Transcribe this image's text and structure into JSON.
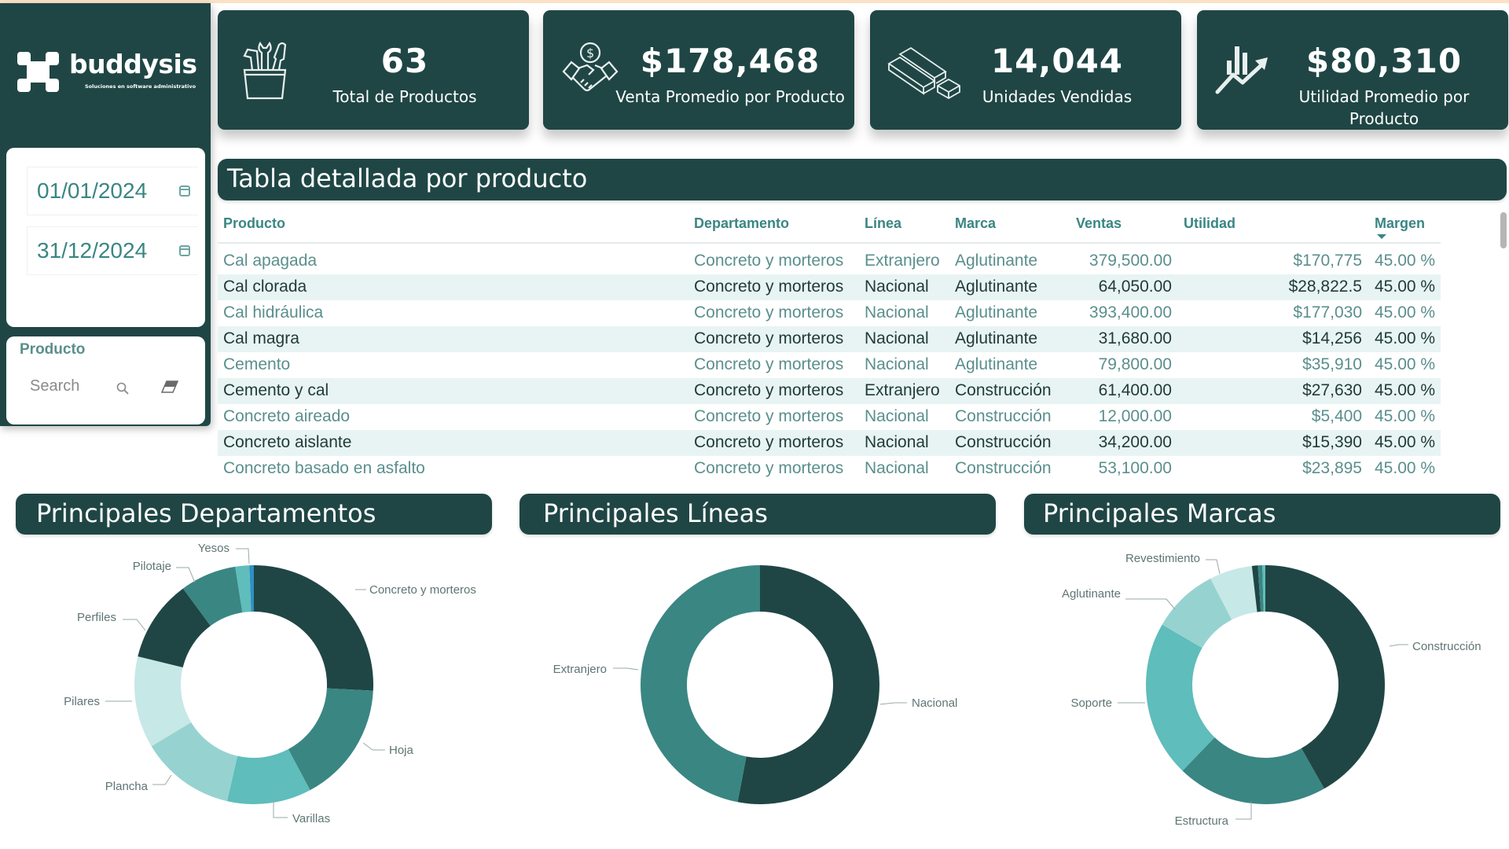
{
  "brand": {
    "name": "buddysis",
    "tagline": "Soluciones en software administrativo"
  },
  "colors": {
    "primary": "#1f4645",
    "top_stripe": "#fbe2c6",
    "accent_teal": "#3a8683",
    "row_alt": "#e8f4f4"
  },
  "filters": {
    "start_date": "01/01/2024",
    "end_date": "31/12/2024",
    "calendar_icon": "calendar-icon",
    "product_slicer": {
      "label": "Producto",
      "search_placeholder": "Search",
      "search_value": "",
      "search_icon": "search-icon",
      "clear_icon": "eraser-icon"
    }
  },
  "kpis": [
    {
      "icon": "tools-bucket-icon",
      "value": "63",
      "label": "Total de Productos"
    },
    {
      "icon": "handshake-money-icon",
      "value": "$178,468",
      "label": "Venta Promedio por Producto"
    },
    {
      "icon": "lumber-stack-icon",
      "value": "14,044",
      "label": "Unidades Vendidas"
    },
    {
      "icon": "chart-growth-icon",
      "value": "$80,310",
      "label": "Utilidad Promedio por Producto"
    }
  ],
  "table": {
    "title": "Tabla detallada por producto",
    "sorted_by": "Margen",
    "sort_direction": "descending",
    "columns": [
      "Producto",
      "Departamento",
      "Línea",
      "Marca",
      "Ventas",
      "Utilidad",
      "Margen"
    ],
    "rows": [
      {
        "producto": "Cal apagada",
        "departamento": "Concreto y morteros",
        "linea": "Extranjero",
        "marca": "Aglutinante",
        "ventas": "379,500.00",
        "utilidad": "$170,775",
        "margen": "45.00 %"
      },
      {
        "producto": "Cal clorada",
        "departamento": "Concreto y morteros",
        "linea": "Nacional",
        "marca": "Aglutinante",
        "ventas": "64,050.00",
        "utilidad": "$28,822.5",
        "margen": "45.00 %"
      },
      {
        "producto": "Cal hidráulica",
        "departamento": "Concreto y morteros",
        "linea": "Nacional",
        "marca": "Aglutinante",
        "ventas": "393,400.00",
        "utilidad": "$177,030",
        "margen": "45.00 %"
      },
      {
        "producto": "Cal magra",
        "departamento": "Concreto y morteros",
        "linea": "Nacional",
        "marca": "Aglutinante",
        "ventas": "31,680.00",
        "utilidad": "$14,256",
        "margen": "45.00 %"
      },
      {
        "producto": "Cemento",
        "departamento": "Concreto y morteros",
        "linea": "Nacional",
        "marca": "Aglutinante",
        "ventas": "79,800.00",
        "utilidad": "$35,910",
        "margen": "45.00 %"
      },
      {
        "producto": "Cemento y cal",
        "departamento": "Concreto y morteros",
        "linea": "Extranjero",
        "marca": "Construcción",
        "ventas": "61,400.00",
        "utilidad": "$27,630",
        "margen": "45.00 %"
      },
      {
        "producto": "Concreto aireado",
        "departamento": "Concreto y morteros",
        "linea": "Nacional",
        "marca": "Construcción",
        "ventas": "12,000.00",
        "utilidad": "$5,400",
        "margen": "45.00 %"
      },
      {
        "producto": "Concreto aislante",
        "departamento": "Concreto y morteros",
        "linea": "Nacional",
        "marca": "Construcción",
        "ventas": "34,200.00",
        "utilidad": "$15,390",
        "margen": "45.00 %"
      },
      {
        "producto": "Concreto basado en asfalto",
        "departamento": "Concreto y morteros",
        "linea": "Nacional",
        "marca": "Construcción",
        "ventas": "53,100.00",
        "utilidad": "$23,895",
        "margen": "45.00 %"
      }
    ]
  },
  "chart_data": [
    {
      "type": "pie",
      "variant": "donut",
      "title": "Principales Departamentos",
      "unit": "percent_of_total_estimated",
      "slices": [
        {
          "label": "Concreto y morteros",
          "value": 25.8,
          "color": "#1f4645"
        },
        {
          "label": "Hoja",
          "value": 16.4,
          "color": "#3a8683"
        },
        {
          "label": "Varillas",
          "value": 11.4,
          "color": "#5fbdbb"
        },
        {
          "label": "Plancha",
          "value": 12.8,
          "color": "#96d3d0"
        },
        {
          "label": "Pilares",
          "value": 12.4,
          "color": "#c6e8e7"
        },
        {
          "label": "Perfiles",
          "value": 11.1,
          "color": "#1f4645"
        },
        {
          "label": "Pilotaje",
          "value": 7.6,
          "color": "#3a8683"
        },
        {
          "label": "Yesos",
          "value": 1.9,
          "color": "#5fbdbb"
        },
        {
          "label": "",
          "value": 0.6,
          "color": "#2f8fc2"
        }
      ],
      "legend": "outside-labels"
    },
    {
      "type": "pie",
      "variant": "donut",
      "title": "Principales Líneas",
      "unit": "percent_of_total_estimated",
      "slices": [
        {
          "label": "Nacional",
          "value": 53,
          "color": "#1f4645"
        },
        {
          "label": "Extranjero",
          "value": 47,
          "color": "#3a8683"
        }
      ],
      "legend": "outside-labels"
    },
    {
      "type": "pie",
      "variant": "donut",
      "title": "Principales Marcas",
      "unit": "percent_of_total_estimated",
      "slices": [
        {
          "label": "Construcción",
          "value": 41.8,
          "color": "#1f4645"
        },
        {
          "label": "Estructura",
          "value": 20.4,
          "color": "#3a8683"
        },
        {
          "label": "Soporte",
          "value": 21.2,
          "color": "#5fbdbb"
        },
        {
          "label": "Aglutinante",
          "value": 9.0,
          "color": "#96d3d0"
        },
        {
          "label": "Revestimiento",
          "value": 5.8,
          "color": "#c6e8e7"
        },
        {
          "label": "",
          "value": 0.8,
          "color": "#1f4645"
        },
        {
          "label": "",
          "value": 0.6,
          "color": "#3a8683"
        },
        {
          "label": "",
          "value": 0.4,
          "color": "#5fbdbb"
        }
      ],
      "legend": "outside-labels"
    }
  ]
}
